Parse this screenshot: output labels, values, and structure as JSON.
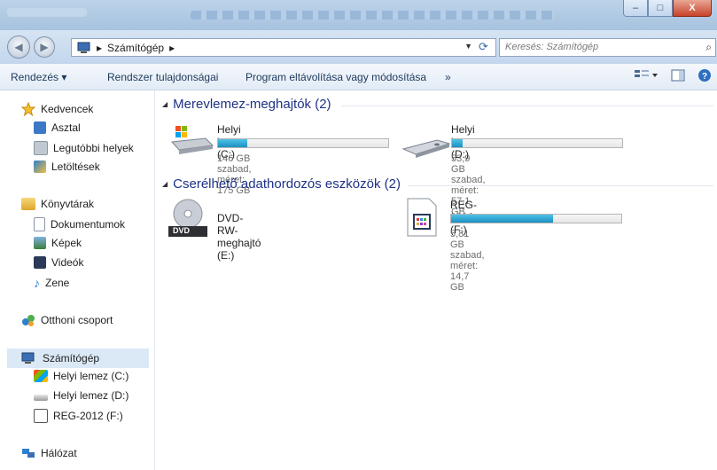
{
  "window": {
    "minimize_glyph": "–",
    "maximize_glyph": "□",
    "close_glyph": "X"
  },
  "address": {
    "crumb_separator": "▸",
    "location": "Számítógép",
    "trailing_arrow": "▸",
    "dropdown_glyph": "▼"
  },
  "search": {
    "placeholder": "Keresés: Számítógép"
  },
  "toolbar": {
    "organize": "Rendezés ▾",
    "system_properties": "Rendszer tulajdonságai",
    "uninstall": "Program eltávolítása vagy módosítása",
    "more": "»"
  },
  "sidebar": {
    "favorites": {
      "label": "Kedvencek",
      "items": [
        "Asztal",
        "Legutóbbi helyek",
        "Letöltések"
      ]
    },
    "libraries": {
      "label": "Könyvtárak",
      "items": [
        "Dokumentumok",
        "Képek",
        "Videók",
        "Zene"
      ]
    },
    "homegroup": "Otthoni csoport",
    "computer": {
      "label": "Számítógép",
      "items": [
        "Helyi lemez (C:)",
        "Helyi lemez (D:)",
        "REG-2012 (F:)"
      ]
    },
    "network": "Hálózat"
  },
  "content": {
    "hdd_group": "Merevlemez-meghajtók (2)",
    "removable_group": "Cserélhető adathordozós eszközök (2)",
    "drives": [
      {
        "name": "Helyi lemez (C:)",
        "info": "146 GB szabad, méret: 175 GB",
        "used_fraction": 0.17
      },
      {
        "name": "Helyi lemez (D:)",
        "info": "53,9 GB szabad, méret: 57,1 GB",
        "used_fraction": 0.06
      },
      {
        "name": "DVD-RW-meghajtó (E:)"
      },
      {
        "name": "REG-2012 (F:)",
        "info": "5,81 GB szabad, méret: 14,7 GB",
        "used_fraction": 0.6
      }
    ],
    "dvd_label": "DVD"
  },
  "colors": {
    "bar_fill": "#1d8fc2",
    "group_header": "#1e3287",
    "selection": "#dbe8f6"
  }
}
